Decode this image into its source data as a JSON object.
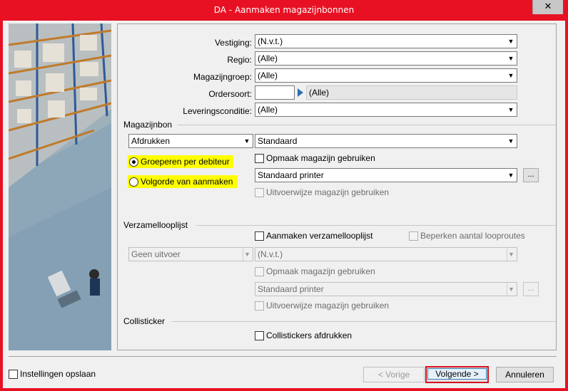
{
  "window": {
    "title": "DA - Aanmaken magazijnbonnen",
    "close_glyph": "✕"
  },
  "filters": {
    "vestiging": {
      "label": "Vestiging:",
      "value": "(N.v.t.)"
    },
    "regio": {
      "label": "Regio:",
      "value": "(Alle)"
    },
    "magazijngroep": {
      "label": "Magazijngroep:",
      "value": "(Alle)"
    },
    "ordersoort": {
      "label": "Ordersoort:",
      "code": "",
      "value": "(Alle)"
    },
    "leveringsconditie": {
      "label": "Leveringsconditie:",
      "value": "(Alle)"
    }
  },
  "magazijnbon": {
    "title": "Magazijnbon",
    "output": "Afdrukken",
    "layout": "Standaard",
    "radio_group": "Groeperen per debiteur",
    "radio_order": "Volgorde van aanmaken",
    "opmaak": "Opmaak magazijn gebruiken",
    "printer": "Standaard printer",
    "printer_btn": "...",
    "uitvoerwijze": "Uitvoerwijze magazijn gebruiken"
  },
  "verzamellooplijst": {
    "title": "Verzamellooplijst",
    "aanmaken": "Aanmaken verzamellooplijst",
    "beperken": "Beperken aantal looproutes",
    "output": "Geen uitvoer",
    "layout": "(N.v.t.)",
    "opmaak": "Opmaak magazijn gebruiken",
    "printer": "Standaard printer",
    "printer_btn": "...",
    "uitvoerwijze": "Uitvoerwijze magazijn gebruiken"
  },
  "collisticker": {
    "title": "Collisticker",
    "afdrukken": "Collistickers afdrukken"
  },
  "footer": {
    "save_settings": "Instellingen opslaan",
    "prev": "< Vorige",
    "next": "Volgende >",
    "cancel": "Annuleren"
  },
  "colors": {
    "title_bar": "#e81123",
    "highlight": "#ffff00",
    "default_button_border": "#d4101e"
  }
}
